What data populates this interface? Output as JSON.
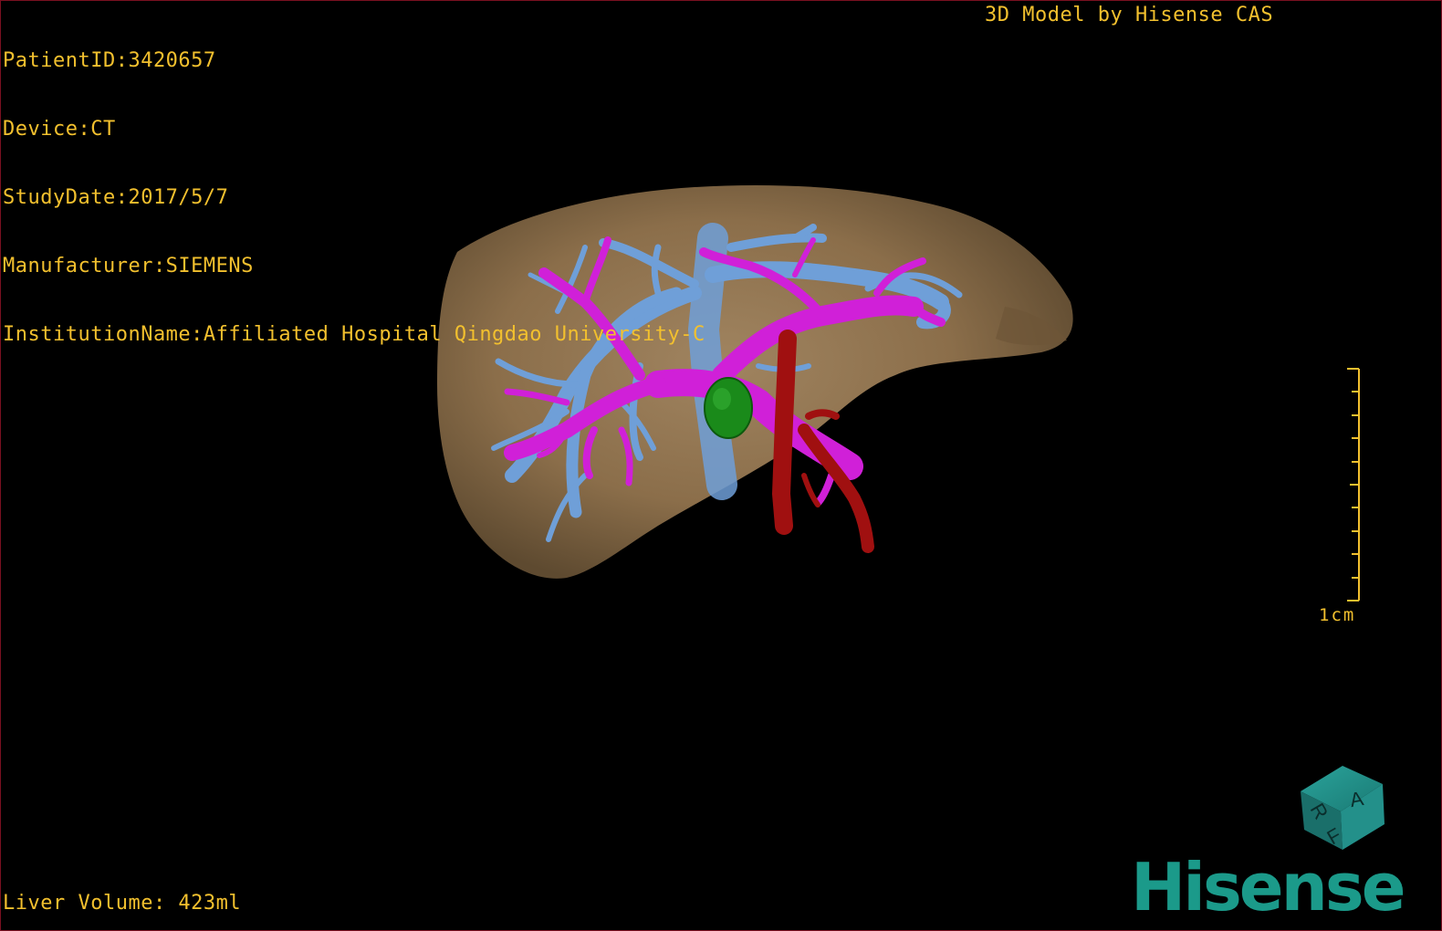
{
  "patient_info": {
    "patient_id": "PatientID:3420657",
    "device": "Device:CT",
    "study_date": "StudyDate:2017/5/7",
    "manufacturer": "Manufacturer:SIEMENS",
    "institution": "InstitutionName:Affiliated Hospital Qingdao University-C"
  },
  "brand_caption": "3D Model by Hisense CAS",
  "liver_volume": "Liver Volume: 423ml",
  "scale_bar": {
    "label": "1cm"
  },
  "orientation_cube": {
    "face_top": "A",
    "face_left": "R",
    "face_front": "F"
  },
  "logo": {
    "text": "Hisense",
    "color": "#1b9a8a"
  },
  "colors": {
    "overlay_text": "#f2c02e",
    "liver": "#8b6e4a",
    "hepatic_vein": "#6f9fd8",
    "portal_vein": "#d020d8",
    "artery": "#a01010",
    "lesion": "#1a8a1a",
    "cube": "#1f8a84"
  },
  "icons": {
    "orientation_cube": "orientation-cube-icon"
  }
}
